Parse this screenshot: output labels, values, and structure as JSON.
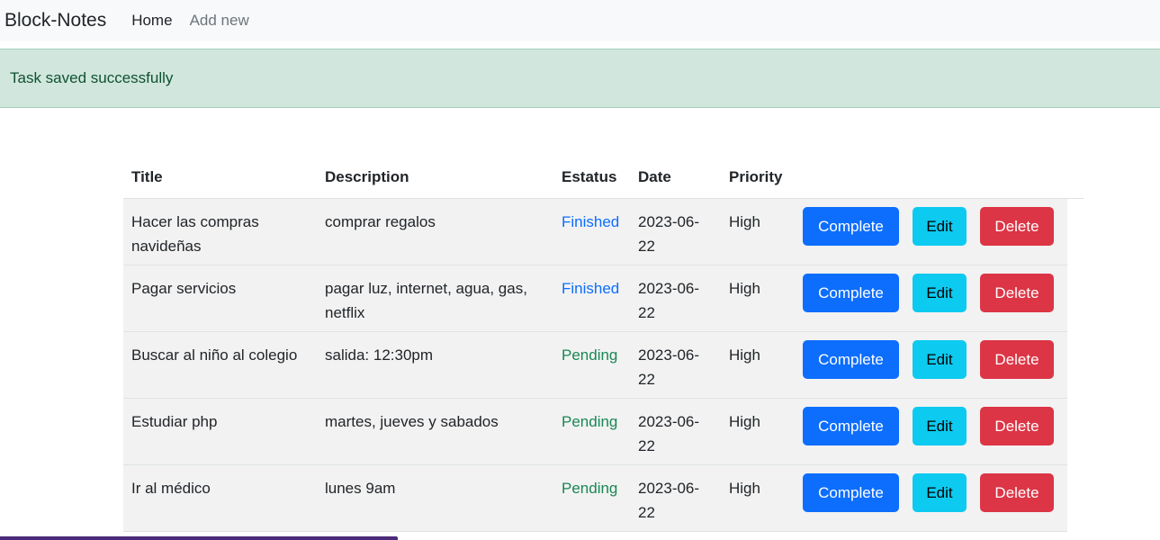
{
  "navbar": {
    "brand": "Block-Notes",
    "links": [
      {
        "label": "Home"
      },
      {
        "label": "Add new"
      }
    ]
  },
  "alert": {
    "message": "Task saved successfully",
    "color": "#d1e7dd"
  },
  "table": {
    "headers": [
      "Title",
      "Description",
      "Estatus",
      "Date",
      "Priority"
    ],
    "rows": [
      {
        "title": "Hacer las compras navideñas",
        "description": "comprar regalos",
        "status": "Finished",
        "date": "2023-06-22",
        "priority": "High"
      },
      {
        "title": "Pagar servicios",
        "description": "pagar luz, internet, agua, gas, netflix",
        "status": "Finished",
        "date": "2023-06-22",
        "priority": "High"
      },
      {
        "title": "Buscar al niño al colegio",
        "description": "salida: 12:30pm",
        "status": "Pending",
        "date": "2023-06-22",
        "priority": "High"
      },
      {
        "title": "Estudiar php",
        "description": "martes, jueves y sabados",
        "status": "Pending",
        "date": "2023-06-22",
        "priority": "High"
      },
      {
        "title": "Ir al médico",
        "description": "lunes 9am",
        "status": "Pending",
        "date": "2023-06-22",
        "priority": "High"
      }
    ],
    "actions": {
      "complete": "Complete",
      "edit": "Edit",
      "delete": "Delete"
    }
  },
  "colors": {
    "primary": "#0d6efd",
    "info": "#0dcaf0",
    "danger": "#dc3545",
    "success": "#198754"
  }
}
